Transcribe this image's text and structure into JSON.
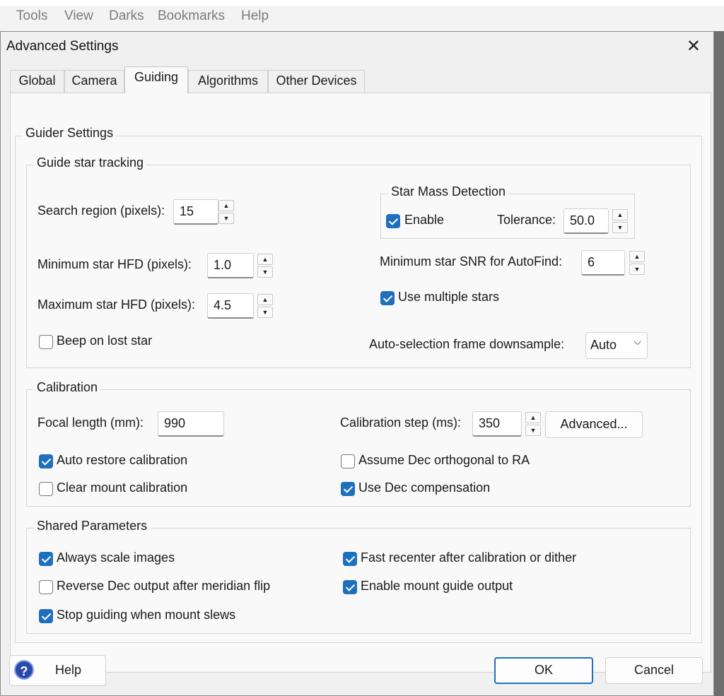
{
  "menubar": {
    "items": [
      "Tools",
      "View",
      "Darks",
      "Bookmarks",
      "Help"
    ]
  },
  "dialog": {
    "title": "Advanced Settings",
    "close_glyph": "✕",
    "tabs": [
      "Global",
      "Camera",
      "Guiding",
      "Algorithms",
      "Other Devices"
    ],
    "active_tab": "Guiding",
    "guider_settings": {
      "title": "Guider Settings",
      "tracking": {
        "title": "Guide star tracking",
        "search_region_label": "Search region (pixels):",
        "search_region_value": "15",
        "min_hfd_label": "Minimum star HFD (pixels):",
        "min_hfd_value": "1.0",
        "max_hfd_label": "Maximum star HFD (pixels):",
        "max_hfd_value": "4.5",
        "beep_label": "Beep on lost star",
        "star_mass": {
          "title": "Star Mass Detection",
          "enable_label": "Enable",
          "tolerance_label": "Tolerance:",
          "tolerance_value": "50.0"
        },
        "min_snr_label": "Minimum star SNR for AutoFind:",
        "min_snr_value": "6",
        "multiple_stars_label": "Use multiple stars",
        "downsample_label": "Auto-selection frame downsample:",
        "downsample_value": "Auto"
      },
      "calibration": {
        "title": "Calibration",
        "focal_length_label": "Focal length (mm):",
        "focal_length_value": "990",
        "step_label": "Calibration step (ms):",
        "step_value": "350",
        "advanced_button": "Advanced...",
        "auto_restore_label": "Auto restore calibration",
        "clear_mount_label": "Clear mount calibration",
        "assume_dec_label": "Assume Dec orthogonal to RA",
        "dec_comp_label": "Use Dec compensation"
      },
      "shared": {
        "title": "Shared Parameters",
        "always_scale_label": "Always scale images",
        "reverse_dec_label": "Reverse Dec output after meridian flip",
        "stop_guiding_label": "Stop guiding when mount slews",
        "fast_recenter_label": "Fast recenter after calibration or dither",
        "enable_output_label": "Enable mount guide output"
      }
    },
    "footer": {
      "help_icon_glyph": "?",
      "help_button": "Help",
      "ok_button": "OK",
      "cancel_button": "Cancel"
    }
  },
  "checkbox_states": {
    "star_mass_enable": true,
    "beep_on_lost_star": false,
    "use_multiple_stars": true,
    "auto_restore_calibration": true,
    "clear_mount_calibration": false,
    "assume_dec_orthogonal": false,
    "use_dec_compensation": true,
    "always_scale_images": true,
    "reverse_dec_output": false,
    "stop_guiding_when_slews": true,
    "fast_recenter": true,
    "enable_mount_guide_output": true
  },
  "colors": {
    "accent": "#1f6fbf",
    "dialog_bg": "#f0f0f0",
    "panel_bg": "#f9f9f9"
  },
  "icons": {
    "close": "close-icon",
    "help": "help-icon",
    "spin_up": "spin-up-icon",
    "spin_down": "spin-down-icon",
    "dropdown": "chevron-down-icon"
  }
}
